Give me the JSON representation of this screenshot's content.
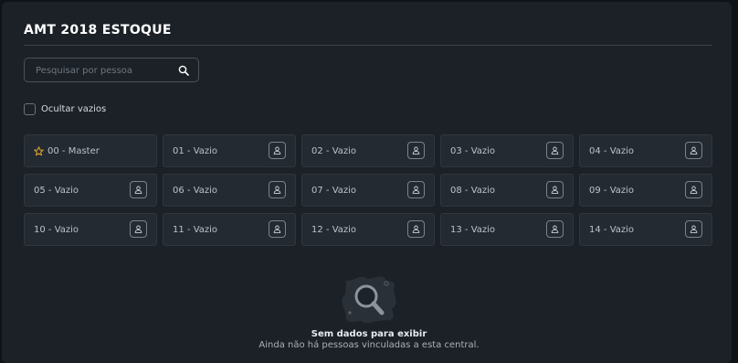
{
  "header": {
    "title": "AMT 2018 ESTOQUE"
  },
  "search": {
    "placeholder": "Pesquisar por pessoa",
    "value": ""
  },
  "filters": {
    "hide_empty_label": "Ocultar vazios",
    "hide_empty_checked": false
  },
  "zones": [
    {
      "label": "00 - Master",
      "icon": "star-icon",
      "accent": "#e0a82e"
    },
    {
      "label": "01 - Vazio",
      "icon": "person-icon"
    },
    {
      "label": "02 - Vazio",
      "icon": "person-icon"
    },
    {
      "label": "03 - Vazio",
      "icon": "person-icon"
    },
    {
      "label": "04 - Vazio",
      "icon": "person-icon"
    },
    {
      "label": "05 - Vazio",
      "icon": "person-icon"
    },
    {
      "label": "06 - Vazio",
      "icon": "person-icon"
    },
    {
      "label": "07 - Vazio",
      "icon": "person-icon"
    },
    {
      "label": "08 - Vazio",
      "icon": "person-icon"
    },
    {
      "label": "09 - Vazio",
      "icon": "person-icon"
    },
    {
      "label": "10 - Vazio",
      "icon": "person-icon"
    },
    {
      "label": "11 - Vazio",
      "icon": "person-icon"
    },
    {
      "label": "12 - Vazio",
      "icon": "person-icon"
    },
    {
      "label": "13 - Vazio",
      "icon": "person-icon"
    },
    {
      "label": "14 - Vazio",
      "icon": "person-icon"
    }
  ],
  "empty_state": {
    "icon": "magnifier-illustration",
    "title": "Sem dados para exibir",
    "subtitle": "Ainda não há pessoas vinculadas a esta central."
  }
}
